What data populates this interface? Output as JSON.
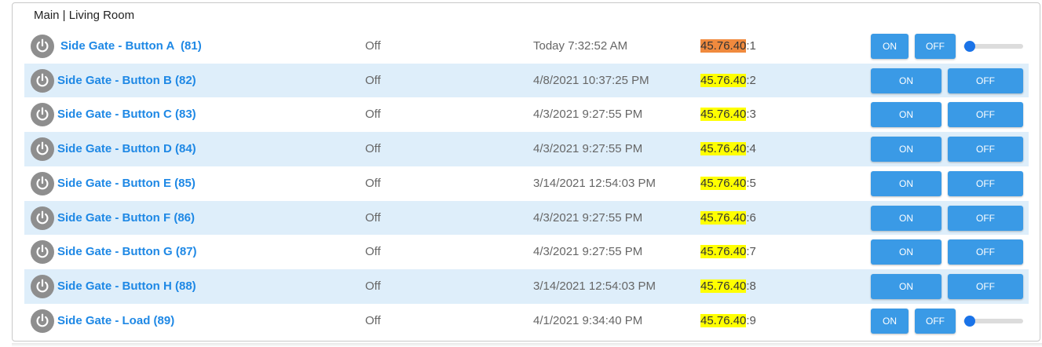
{
  "panel": {
    "title": "Main | Living Room"
  },
  "rows": [
    {
      "name": "Side Gate - Button A  (81)",
      "status": "Off",
      "time": "Today 7:32:52 AM",
      "addr_hl": "45.76.40",
      "addr_rest": ":1",
      "on_label": "ON",
      "off_label": "OFF",
      "slider_level": 0
    },
    {
      "name": "Side Gate - Button B (82)",
      "status": "Off",
      "time": "4/8/2021 10:37:25 PM",
      "addr_hl": "45.76.40",
      "addr_rest": ":2",
      "on_label": "ON",
      "off_label": "OFF"
    },
    {
      "name": "Side Gate - Button C (83)",
      "status": "Off",
      "time": "4/3/2021 9:27:55 PM",
      "addr_hl": "45.76.40",
      "addr_rest": ":3",
      "on_label": "ON",
      "off_label": "OFF"
    },
    {
      "name": "Side Gate - Button D (84)",
      "status": "Off",
      "time": "4/3/2021 9:27:55 PM",
      "addr_hl": "45.76.40",
      "addr_rest": ":4",
      "on_label": "ON",
      "off_label": "OFF"
    },
    {
      "name": "Side Gate - Button E (85)",
      "status": "Off",
      "time": "3/14/2021 12:54:03 PM",
      "addr_hl": "45.76.40",
      "addr_rest": ":5",
      "on_label": "ON",
      "off_label": "OFF"
    },
    {
      "name": "Side Gate - Button F (86)",
      "status": "Off",
      "time": "4/3/2021 9:27:55 PM",
      "addr_hl": "45.76.40",
      "addr_rest": ":6",
      "on_label": "ON",
      "off_label": "OFF"
    },
    {
      "name": "Side Gate - Button G (87)",
      "status": "Off",
      "time": "4/3/2021 9:27:55 PM",
      "addr_hl": "45.76.40",
      "addr_rest": ":7",
      "on_label": "ON",
      "off_label": "OFF"
    },
    {
      "name": "Side Gate - Button H (88)",
      "status": "Off",
      "time": "3/14/2021 12:54:03 PM",
      "addr_hl": "45.76.40",
      "addr_rest": ":8",
      "on_label": "ON",
      "off_label": "OFF"
    },
    {
      "name": "Side Gate - Load (89)",
      "status": "Off",
      "time": "4/1/2021 9:34:40 PM",
      "addr_hl": "45.76.40",
      "addr_rest": ":9",
      "on_label": "ON",
      "off_label": "OFF",
      "slider_level": 0
    }
  ],
  "colors": {
    "link": "#1e88e5",
    "button": "#3a9ae6",
    "row_alt": "#deeefa",
    "highlight": "#ffff00",
    "highlight_active": "#f08a3e",
    "power_icon_bg": "#8e8e8e",
    "slider_thumb": "#1a73e8"
  },
  "icons": {
    "device": "power-icon"
  }
}
